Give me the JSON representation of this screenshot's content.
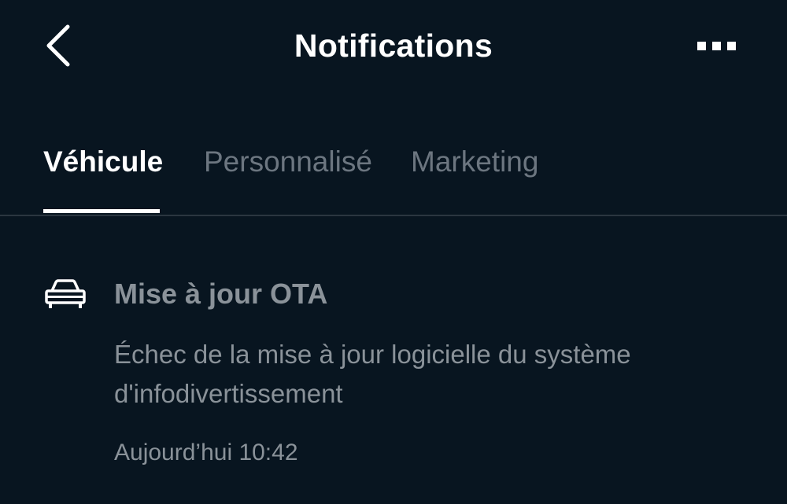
{
  "header": {
    "title": "Notifications",
    "back_icon": "chevron-left-icon",
    "more_icon": "more-horizontal-icon"
  },
  "tabs": [
    {
      "label": "Véhicule",
      "active": true
    },
    {
      "label": "Personnalisé",
      "active": false
    },
    {
      "label": "Marketing",
      "active": false
    }
  ],
  "notifications": [
    {
      "icon": "car-icon",
      "title": "Mise à jour OTA",
      "body": "Échec de la mise à jour logicielle du système d'infodivertissement",
      "time": "Aujourd’hui 10:42"
    }
  ],
  "colors": {
    "background": "#081520",
    "text_primary": "#ffffff",
    "text_muted": "#8a9299",
    "tab_inactive": "#6c7680",
    "divider": "#2b3640"
  }
}
